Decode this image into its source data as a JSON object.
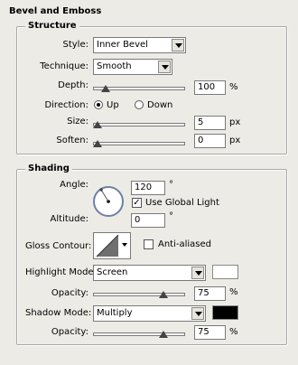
{
  "panel": {
    "title": "Bevel and Emboss"
  },
  "structure": {
    "legend": "Structure",
    "style": {
      "label": "Style:",
      "value": "Inner Bevel"
    },
    "technique": {
      "label": "Technique:",
      "value": "Smooth"
    },
    "depth": {
      "label": "Depth:",
      "value": "100",
      "unit": "%",
      "level": 0.05
    },
    "direction": {
      "label": "Direction:",
      "up": "Up",
      "down": "Down",
      "selected": "Up"
    },
    "size": {
      "label": "Size:",
      "value": "5",
      "unit": "px",
      "level": 0.0
    },
    "soften": {
      "label": "Soften:",
      "value": "0",
      "unit": "px",
      "level": 0.0
    }
  },
  "shading": {
    "legend": "Shading",
    "angle": {
      "label": "Angle:",
      "value": "120",
      "unit": "°"
    },
    "use_global_light": {
      "label": "Use Global Light",
      "checked": true
    },
    "altitude": {
      "label": "Altitude:",
      "value": "0",
      "unit": "°"
    },
    "gloss_contour": {
      "label": "Gloss Contour:"
    },
    "anti_aliased": {
      "label": "Anti-aliased",
      "checked": false
    },
    "highlight_mode": {
      "label": "Highlight Mode:",
      "value": "Screen",
      "color": "#ffffff"
    },
    "highlight_opacity": {
      "label": "Opacity:",
      "value": "75",
      "unit": "%",
      "level": 0.75
    },
    "shadow_mode": {
      "label": "Shadow Mode:",
      "value": "Multiply",
      "color": "#000000"
    },
    "shadow_opacity": {
      "label": "Opacity:",
      "value": "75",
      "unit": "%",
      "level": 0.75
    }
  }
}
